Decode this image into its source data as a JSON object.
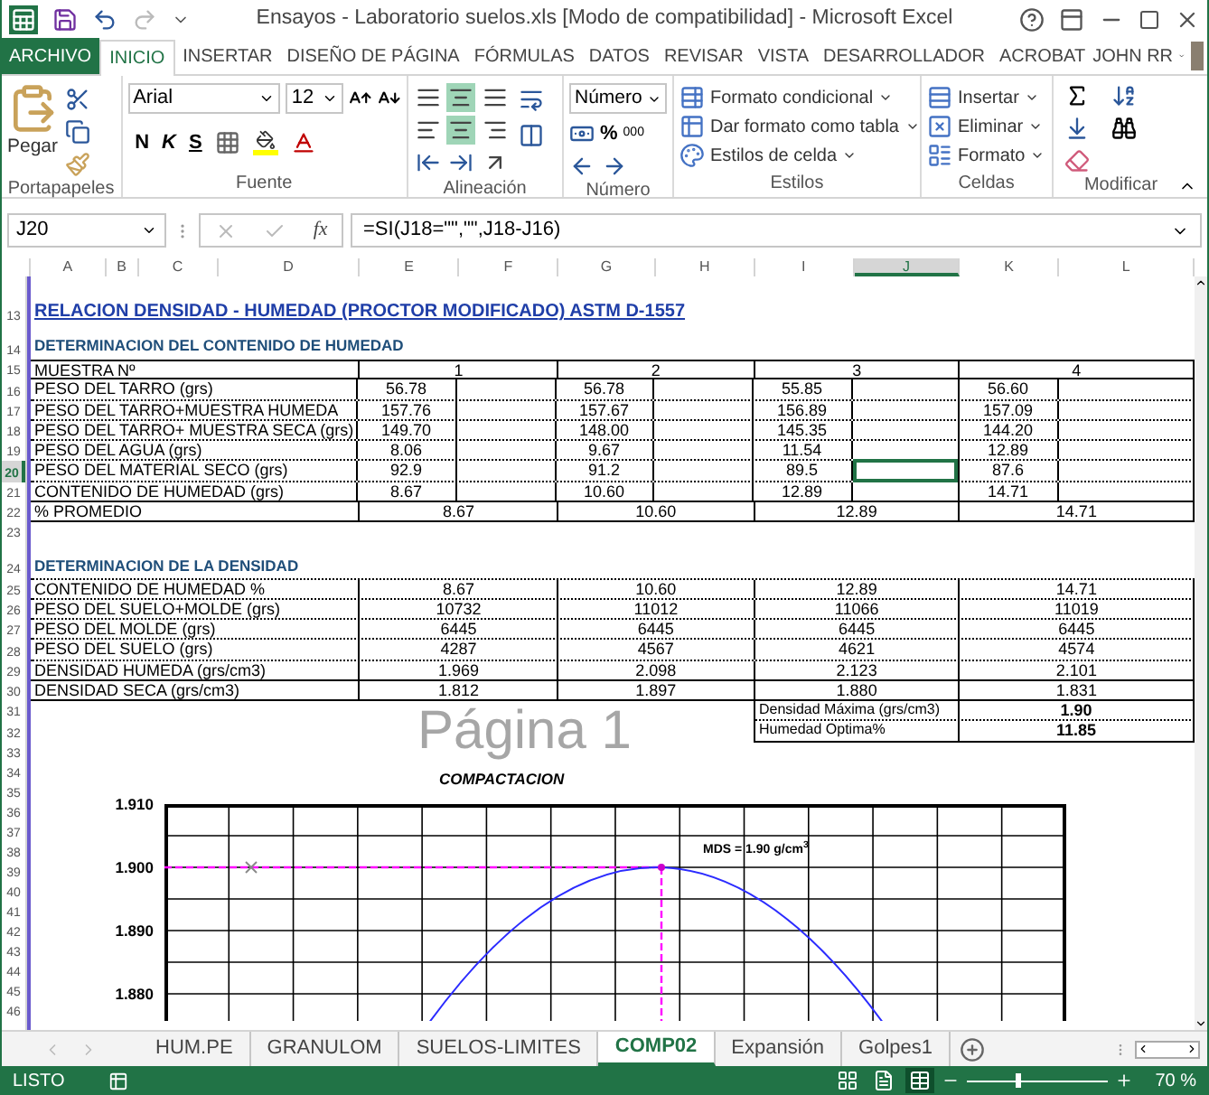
{
  "window": {
    "title": "Ensayos - Laboratorio suelos.xls  [Modo de compatibilidad] - Microsoft Excel"
  },
  "ribbon_tabs": [
    {
      "label": "ARCHIVO",
      "kind": "file",
      "selected": false
    },
    {
      "label": "INICIO",
      "kind": "tab",
      "selected": true
    },
    {
      "label": "INSERTAR",
      "kind": "tab",
      "selected": false
    },
    {
      "label": "DISEÑO DE PÁGINA",
      "kind": "tab",
      "selected": false
    },
    {
      "label": "FÓRMULAS",
      "kind": "tab",
      "selected": false
    },
    {
      "label": "DATOS",
      "kind": "tab",
      "selected": false
    },
    {
      "label": "REVISAR",
      "kind": "tab",
      "selected": false
    },
    {
      "label": "VISTA",
      "kind": "tab",
      "selected": false
    },
    {
      "label": "DESARROLLADOR",
      "kind": "tab",
      "selected": false
    },
    {
      "label": "ACROBAT",
      "kind": "tab",
      "selected": false
    }
  ],
  "user": {
    "name": "JOHN RR"
  },
  "ribbon": {
    "clipboard": {
      "label": "Portapapeles",
      "paste": "Pegar"
    },
    "font": {
      "label": "Fuente",
      "name": "Arial",
      "size": "12",
      "bold": "N",
      "italic": "K",
      "underline": "S"
    },
    "alignment": {
      "label": "Alineación",
      "buttons": [
        {
          "kind": "top",
          "selected": false
        },
        {
          "kind": "middle",
          "selected": true
        },
        {
          "kind": "bottom",
          "selected": false
        },
        {
          "kind": "left",
          "selected": false
        },
        {
          "kind": "center",
          "selected": true
        },
        {
          "kind": "right",
          "selected": false
        }
      ]
    },
    "number": {
      "label": "Número",
      "format": "Número",
      "percent": "%",
      "thousands": "000"
    },
    "styles": {
      "label": "Estilos",
      "items": [
        "Formato condicional",
        "Dar formato como tabla",
        "Estilos de celda"
      ]
    },
    "cells": {
      "label": "Celdas",
      "items": [
        "Insertar",
        "Eliminar",
        "Formato"
      ]
    },
    "editing": {
      "label": "Modificar"
    }
  },
  "formula_bar": {
    "name_box": "J20",
    "fx": "fx",
    "formula": "=SI(J18=\"\",\"\",J18-J16)"
  },
  "columns": [
    {
      "label": "A",
      "selected": false
    },
    {
      "label": "B",
      "selected": false
    },
    {
      "label": "C",
      "selected": false
    },
    {
      "label": "D",
      "selected": false
    },
    {
      "label": "E",
      "selected": false
    },
    {
      "label": "F",
      "selected": false
    },
    {
      "label": "G",
      "selected": false
    },
    {
      "label": "H",
      "selected": false
    },
    {
      "label": "I",
      "selected": false
    },
    {
      "label": "J",
      "selected": true
    },
    {
      "label": "K",
      "selected": false
    },
    {
      "label": "L",
      "selected": false
    }
  ],
  "row_numbers": [
    {
      "label": "13",
      "selected": false
    },
    {
      "label": "14",
      "selected": false
    },
    {
      "label": "15",
      "selected": false
    },
    {
      "label": "16",
      "selected": false
    },
    {
      "label": "17",
      "selected": false
    },
    {
      "label": "18",
      "selected": false
    },
    {
      "label": "19",
      "selected": false
    },
    {
      "label": "20",
      "selected": true
    },
    {
      "label": "21",
      "selected": false
    },
    {
      "label": "22",
      "selected": false
    },
    {
      "label": "23",
      "selected": false
    },
    {
      "label": "24",
      "selected": false
    },
    {
      "label": "25",
      "selected": false
    },
    {
      "label": "26",
      "selected": false
    },
    {
      "label": "27",
      "selected": false
    },
    {
      "label": "28",
      "selected": false
    },
    {
      "label": "29",
      "selected": false
    },
    {
      "label": "30",
      "selected": false
    },
    {
      "label": "31",
      "selected": false
    },
    {
      "label": "32",
      "selected": false
    },
    {
      "label": "33",
      "selected": false
    },
    {
      "label": "34",
      "selected": false
    },
    {
      "label": "35",
      "selected": false
    },
    {
      "label": "36",
      "selected": false
    },
    {
      "label": "37",
      "selected": false
    },
    {
      "label": "38",
      "selected": false
    },
    {
      "label": "39",
      "selected": false
    },
    {
      "label": "40",
      "selected": false
    },
    {
      "label": "41",
      "selected": false
    },
    {
      "label": "42",
      "selected": false
    },
    {
      "label": "43",
      "selected": false
    },
    {
      "label": "44",
      "selected": false
    },
    {
      "label": "45",
      "selected": false
    },
    {
      "label": "46",
      "selected": false
    }
  ],
  "sheet": {
    "title": "RELACION DENSIDAD - HUMEDAD (PROCTOR MODIFICADO) ASTM D-1557",
    "moisture": {
      "heading": "DETERMINACION DEL CONTENIDO DE HUMEDAD",
      "header": {
        "label": "MUESTRA Nº",
        "samples": [
          "1",
          "2",
          "3",
          "4"
        ]
      },
      "rows": [
        {
          "label": "PESO DEL TARRO (grs)",
          "values": [
            "56.78",
            "56.78",
            "55.85",
            "56.60"
          ],
          "selected": [
            false,
            false,
            false,
            false
          ]
        },
        {
          "label": "PESO DEL TARRO+MUESTRA HUMEDA",
          "values": [
            "157.76",
            "157.67",
            "156.89",
            "157.09"
          ],
          "selected": [
            false,
            false,
            false,
            false
          ]
        },
        {
          "label": "PESO DEL TARRO+ MUESTRA SECA  (grs)",
          "values": [
            "149.70",
            "148.00",
            "145.35",
            "144.20"
          ],
          "selected": [
            false,
            false,
            false,
            false
          ]
        },
        {
          "label": "PESO DEL AGUA (grs)",
          "values": [
            "8.06",
            "9.67",
            "11.54",
            "12.89"
          ],
          "selected": [
            false,
            false,
            false,
            false
          ]
        },
        {
          "label": "PESO DEL MATERIAL SECO (grs)",
          "values": [
            "92.9",
            "91.2",
            "89.5",
            "87.6"
          ],
          "selected": [
            false,
            false,
            true,
            false
          ]
        },
        {
          "label": "CONTENIDO DE HUMEDAD (grs)",
          "values": [
            "8.67",
            "10.60",
            "12.89",
            "14.71"
          ],
          "selected": [
            false,
            false,
            false,
            false
          ]
        }
      ],
      "average": {
        "label": "% PROMEDIO",
        "values": [
          "8.67",
          "10.60",
          "12.89",
          "14.71"
        ]
      }
    },
    "density": {
      "heading": "DETERMINACION DE LA DENSIDAD",
      "rows": [
        {
          "label": "CONTENIDO DE HUMEDAD %",
          "values": [
            "8.67",
            "10.60",
            "12.89",
            "14.71"
          ]
        },
        {
          "label": "PESO DEL SUELO+MOLDE (grs)",
          "values": [
            "10732",
            "11012",
            "11066",
            "11019"
          ]
        },
        {
          "label": "PESO DEL MOLDE (grs)",
          "values": [
            "6445",
            "6445",
            "6445",
            "6445"
          ]
        },
        {
          "label": "PESO DEL SUELO (grs)",
          "values": [
            "4287",
            "4567",
            "4621",
            "4574"
          ]
        },
        {
          "label": "DENSIDAD HUMEDA (grs/cm3)",
          "values": [
            "1.969",
            "2.098",
            "2.123",
            "2.101"
          ]
        },
        {
          "label": "DENSIDAD SECA (grs/cm3)",
          "values": [
            "1.812",
            "1.897",
            "1.880",
            "1.831"
          ]
        }
      ],
      "summary": [
        {
          "label": "Densidad Máxima (grs/cm3)",
          "value": "1.90"
        },
        {
          "label": "Humedad Optima%",
          "value": "11.85"
        }
      ]
    },
    "page_label": "Página 1",
    "chart": {
      "title": "COMPACTACION",
      "y_tick_labels": [
        "1.910",
        "1.900",
        "1.890",
        "1.880"
      ],
      "annotation": "MDS = 1.90 g/cm$^{3}$"
    }
  },
  "sheet_tabs": [
    {
      "label": "HUM.PE",
      "selected": false
    },
    {
      "label": "GRANULOM",
      "selected": false
    },
    {
      "label": "SUELOS-LIMITES",
      "selected": false
    },
    {
      "label": "COMP02",
      "selected": true
    },
    {
      "label": "Expansión",
      "selected": false
    },
    {
      "label": "Golpes1",
      "selected": false
    }
  ],
  "status_bar": {
    "text": "LISTO",
    "views": [
      {
        "kind": "normal",
        "selected": false
      },
      {
        "kind": "page_layout",
        "selected": false
      },
      {
        "kind": "page_break",
        "selected": true
      }
    ],
    "zoom_slider": {
      "level": 0.35
    },
    "zoom": "70 %"
  }
}
